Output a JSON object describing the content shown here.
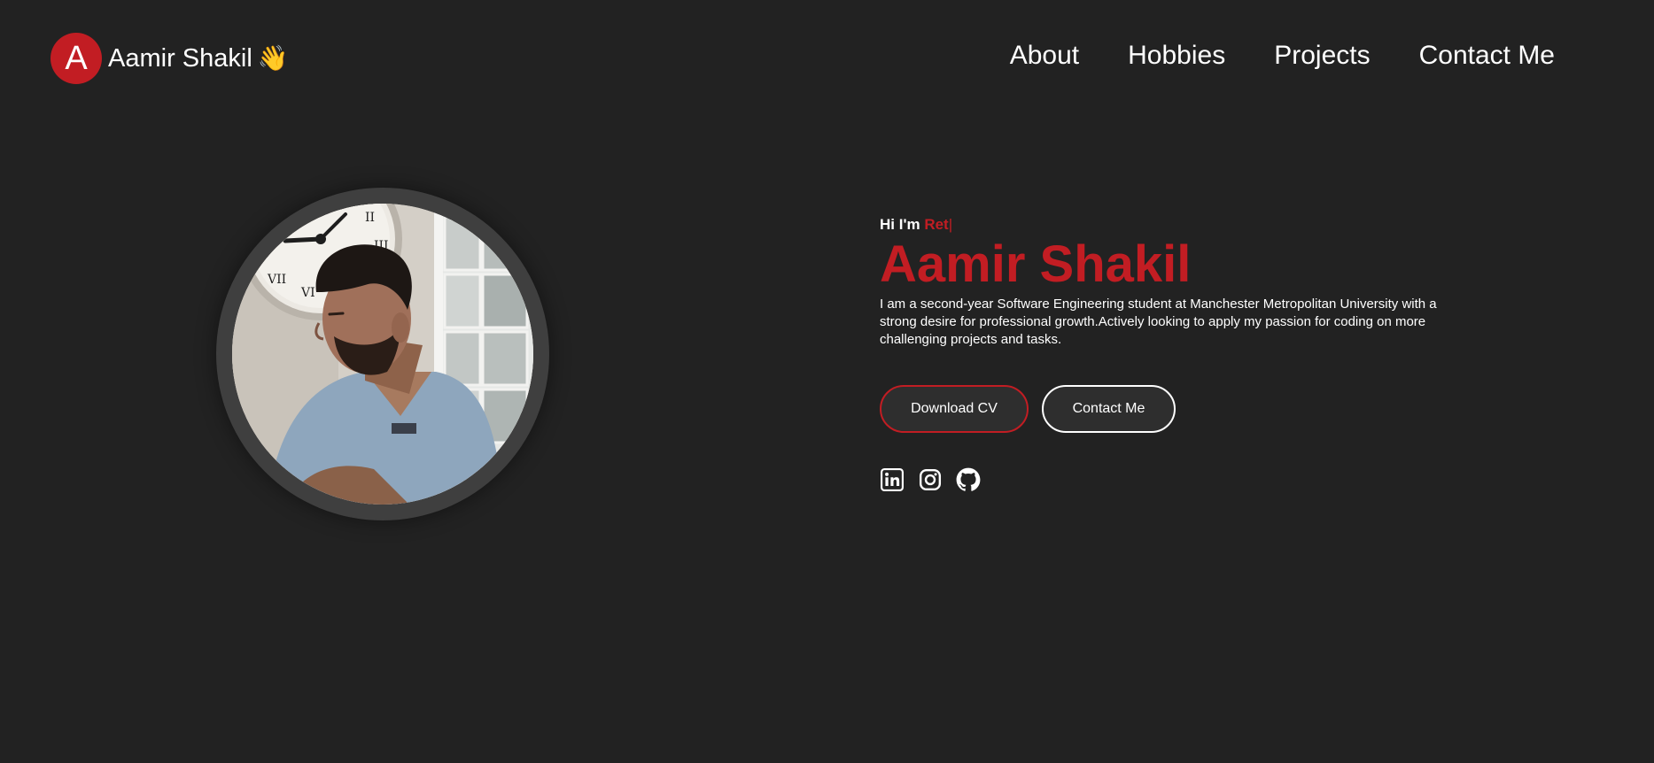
{
  "header": {
    "logo_letter": "A",
    "brand_name": "Aamir Shakil",
    "brand_emoji": "👋",
    "nav": [
      {
        "label": "About"
      },
      {
        "label": "Hobbies"
      },
      {
        "label": "Projects"
      },
      {
        "label": "Contact Me"
      }
    ]
  },
  "hero": {
    "greeting_prefix": "Hi I'm ",
    "typed_text": "Ret",
    "typing_cursor": "|",
    "name": "Aamir Shakil",
    "bio": "I am a second-year Software Engineering student at Manchester Metropolitan University with a strong desire for professional growth.Actively looking to apply my passion for coding on more challenging projects and tasks.",
    "buttons": {
      "download_cv": "Download CV",
      "contact_me": "Contact Me"
    },
    "socials": [
      {
        "icon": "linkedin-icon"
      },
      {
        "icon": "instagram-icon"
      },
      {
        "icon": "github-icon"
      }
    ]
  },
  "colors": {
    "background": "#222222",
    "accent": "#c21d23",
    "text": "#ffffff",
    "button_bg": "#2e2e2e"
  }
}
